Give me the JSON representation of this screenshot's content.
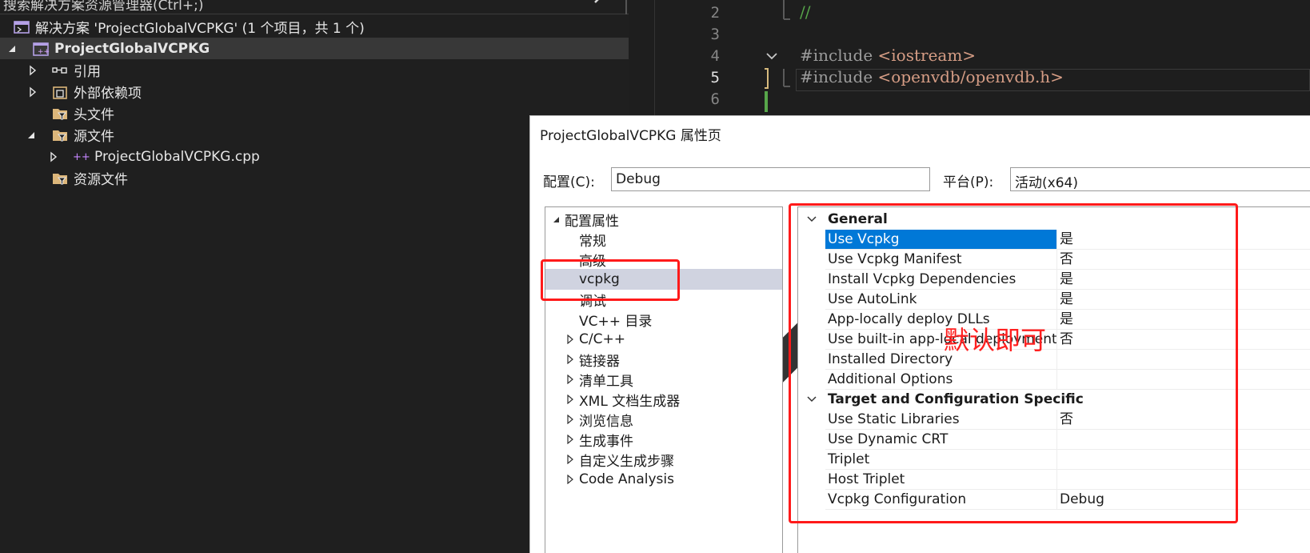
{
  "solution_explorer": {
    "search_placeholder": "搜索解决方案资源管理器(Ctrl+;)",
    "solution_label": "解决方案 'ProjectGlobalVCPKG' (1 个项目，共 1 个)",
    "project_name": "ProjectGlobalVCPKG",
    "nodes": {
      "references": "引用",
      "external_deps": "外部依赖项",
      "header_files": "头文件",
      "source_files": "源文件",
      "cpp_file": "ProjectGlobalVCPKG.cpp",
      "resource_files": "资源文件"
    }
  },
  "editor": {
    "line_numbers": [
      "2",
      "3",
      "4",
      "5",
      "6"
    ],
    "lines": {
      "l2_comment": "//",
      "l4_directive": "#include ",
      "l4_path": "<iostream>",
      "l5_directive": "#include ",
      "l5_path": "<openvdb/openvdb.h>"
    }
  },
  "dialog": {
    "title": "ProjectGlobalVCPKG 属性页",
    "config_label": "配置(C):",
    "config_value": "Debug",
    "platform_label": "平台(P):",
    "platform_value": "活动(x64)",
    "tree": {
      "root": "配置属性",
      "general": "常规",
      "advanced": "高级",
      "vcpkg": "vcpkg",
      "debugging": "调试",
      "vc_dirs": "VC++ 目录",
      "cpp": "C/C++",
      "linker": "链接器",
      "manifest_tool": "清单工具",
      "xml_doc": "XML 文档生成器",
      "browse_info": "浏览信息",
      "build_events": "生成事件",
      "custom_build": "自定义生成步骤",
      "code_analysis": "Code Analysis"
    },
    "grid": {
      "cat_general": "General",
      "cat_target": "Target and Configuration Specific",
      "rows": [
        {
          "name": "Use Vcpkg",
          "value": "是"
        },
        {
          "name": "Use Vcpkg Manifest",
          "value": "否"
        },
        {
          "name": "Install Vcpkg Dependencies",
          "value": "是"
        },
        {
          "name": "Use AutoLink",
          "value": "是"
        },
        {
          "name": "App-locally deploy DLLs",
          "value": "是"
        },
        {
          "name": "Use built-in app-local deployment",
          "value": "否"
        },
        {
          "name": "Installed Directory",
          "value": ""
        },
        {
          "name": "Additional Options",
          "value": ""
        },
        {
          "name": "Use Static Libraries",
          "value": "否"
        },
        {
          "name": "Use Dynamic CRT",
          "value": ""
        },
        {
          "name": "Triplet",
          "value": ""
        },
        {
          "name": "Host Triplet",
          "value": ""
        },
        {
          "name": "Vcpkg Configuration",
          "value": "Debug"
        }
      ]
    }
  },
  "annotation": {
    "text": "默认即可",
    "color": "#ff1a1a"
  }
}
